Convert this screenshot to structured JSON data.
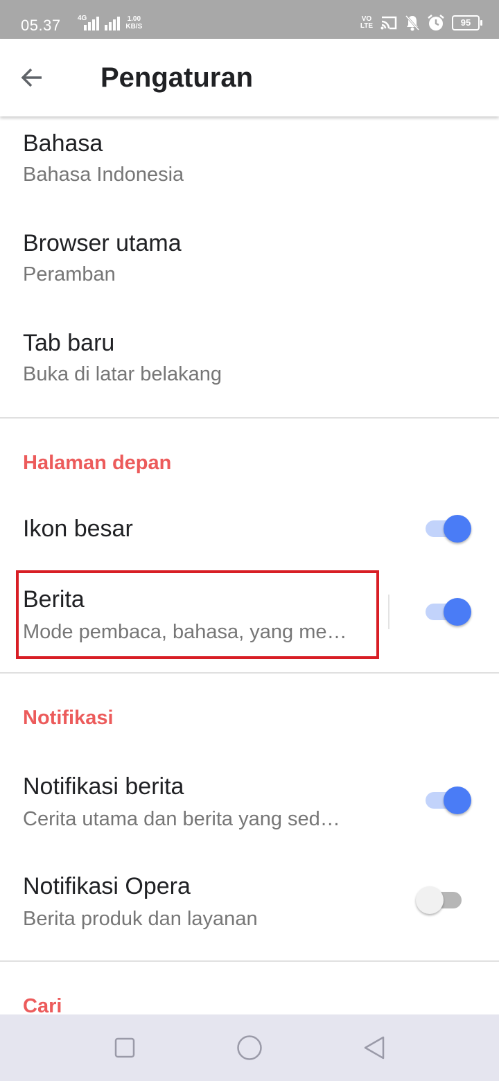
{
  "status_bar": {
    "time": "05.37",
    "network_tag": "4G",
    "speed_value": "1.00",
    "speed_unit": "KB/S",
    "volte_line1": "VO",
    "volte_line2": "LTE",
    "battery": "95"
  },
  "toolbar": {
    "title": "Pengaturan",
    "back_icon": "arrow-left-icon"
  },
  "settings": {
    "bahasa": {
      "title": "Bahasa",
      "subtitle": "Bahasa Indonesia"
    },
    "browser_utama": {
      "title": "Browser utama",
      "subtitle": "Peramban"
    },
    "tab_baru": {
      "title": "Tab baru",
      "subtitle": "Buka di latar belakang"
    }
  },
  "halaman_depan": {
    "header": "Halaman depan",
    "ikon_besar": {
      "title": "Ikon besar",
      "enabled": true
    },
    "berita": {
      "title": "Berita",
      "subtitle": "Mode pembaca, bahasa, yang me…",
      "enabled": true
    }
  },
  "notifikasi": {
    "header": "Notifikasi",
    "notifikasi_berita": {
      "title": "Notifikasi berita",
      "subtitle": "Cerita utama dan berita yang sed…",
      "enabled": true
    },
    "notifikasi_opera": {
      "title": "Notifikasi Opera",
      "subtitle": "Berita produk dan layanan",
      "enabled": false
    }
  },
  "cari": {
    "header": "Cari"
  },
  "colors": {
    "section_header": "#ec5b5b",
    "toggle_on": "#4a7cf6",
    "toggle_track_on": "#c2d3fb",
    "highlight": "#d81e25"
  },
  "nav_bar": {
    "recents_icon": "square-icon",
    "home_icon": "circle-icon",
    "back_icon": "triangle-back-icon"
  }
}
